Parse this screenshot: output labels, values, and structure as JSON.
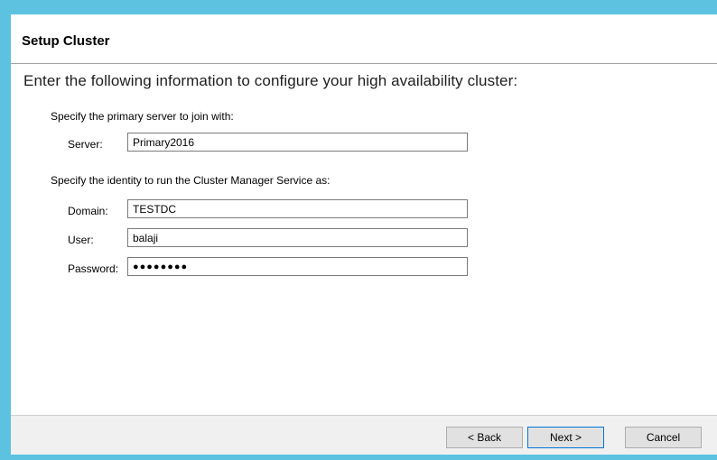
{
  "header": {
    "title": "Setup Cluster"
  },
  "content": {
    "intro": "Enter the following information to configure your high availability cluster:",
    "primary_section_label": "Specify the primary server to join with:",
    "server": {
      "label": "Server:",
      "value": "Primary2016"
    },
    "identity_section_label": "Specify the identity to run the Cluster Manager Service as:",
    "domain": {
      "label": "Domain:",
      "value": "TESTDC"
    },
    "user": {
      "label": "User:",
      "value": "balaji"
    },
    "password": {
      "label": "Password:",
      "value": "●●●●●●●●"
    }
  },
  "buttons": {
    "back": "< Back",
    "next": "Next >",
    "cancel": "Cancel"
  },
  "colors": {
    "window_border": "#5cc2e0",
    "dialog_background": "#f0f0f0",
    "default_button_border": "#0078d7"
  }
}
